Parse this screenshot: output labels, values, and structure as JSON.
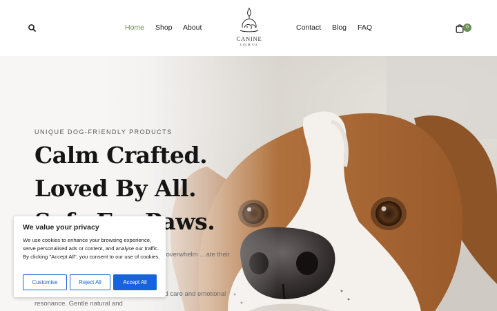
{
  "header": {
    "search_icon": "search-icon",
    "nav_left": [
      "Home",
      "Shop",
      "About"
    ],
    "nav_right": [
      "Contact",
      "Blog",
      "FAQ"
    ],
    "active_item": "Home",
    "logo_title": "CANINE",
    "logo_subtitle": "CALM CO.",
    "cart_icon": "shopping-bag-icon",
    "cart_count": "0"
  },
  "hero": {
    "eyebrow": "UNIQUE DOG-FRIENDLY PRODUCTS",
    "headline_lines": [
      "Calm Crafted.",
      "Loved By All.",
      "Safe For Paws."
    ],
    "paragraph_1": "…grances. With noses which …these scents overwhelm …ate their airways and skin.",
    "paragraph_2": "…ate home wellness scents with evidence led care and emotional resonance. Gentle natural and",
    "image": "close-up photo of a beagle dog"
  },
  "cookie_banner": {
    "title": "We value your privacy",
    "text": "We use cookies to enhance your browsing experience, serve personalised ads or content, and analyse our traffic. By clicking \"Accept All\", you consent to our use of cookies.",
    "customise": "Customise",
    "reject": "Reject All",
    "accept": "Accept All"
  },
  "colors": {
    "accent_green": "#6d8e58",
    "cookie_blue": "#1863dc",
    "headline": "#151515"
  }
}
